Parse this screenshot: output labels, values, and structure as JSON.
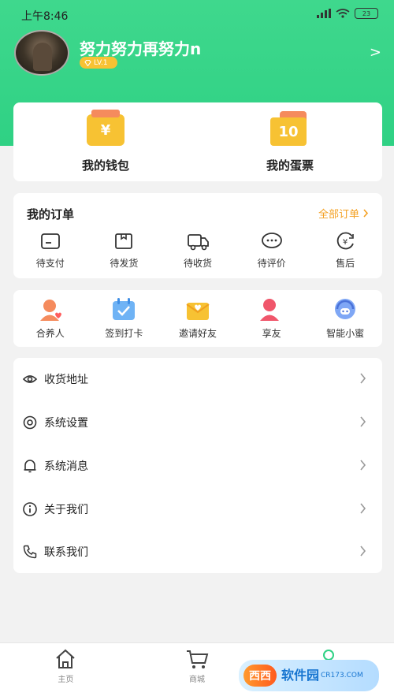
{
  "status_bar": {
    "time": "上午8:46",
    "battery": "23"
  },
  "profile": {
    "username": "努力努力再努力n",
    "level": "LV.1",
    "arrow": ">"
  },
  "wallet": {
    "wallet_icon_glyph": "¥",
    "wallet_label": "我的钱包",
    "ticket_icon_glyph": "10",
    "ticket_label": "我的蛋票"
  },
  "orders": {
    "title": "我的订单",
    "all_label": "全部订单",
    "items": [
      {
        "label": "待支付",
        "icon": "card-icon"
      },
      {
        "label": "待发货",
        "icon": "box-icon"
      },
      {
        "label": "待收货",
        "icon": "truck-icon"
      },
      {
        "label": "待评价",
        "icon": "chat-icon"
      },
      {
        "label": "售后",
        "icon": "yen-icon"
      }
    ]
  },
  "services": [
    {
      "label": "合养人",
      "icon": "partner-icon"
    },
    {
      "label": "签到打卡",
      "icon": "calendar-icon"
    },
    {
      "label": "邀请好友",
      "icon": "invite-icon"
    },
    {
      "label": "享友",
      "icon": "share-friend-icon"
    },
    {
      "label": "智能小蜜",
      "icon": "assistant-icon"
    }
  ],
  "menu": [
    {
      "label": "收货地址",
      "icon": "eye-icon"
    },
    {
      "label": "系统设置",
      "icon": "settings-icon"
    },
    {
      "label": "系统消息",
      "icon": "bell-icon"
    },
    {
      "label": "关于我们",
      "icon": "info-icon"
    },
    {
      "label": "联系我们",
      "icon": "phone-icon"
    }
  ],
  "tabbar": [
    {
      "label": "主页",
      "icon": "home-icon"
    },
    {
      "label": "商城",
      "icon": "cart-icon"
    },
    {
      "label": "",
      "icon": "user-icon"
    }
  ],
  "watermark": {
    "logo": "西西",
    "text": "软件园",
    "sub": "CR173.COM"
  },
  "colors": {
    "brand_green": "#2fd184",
    "accent_orange": "#f4a021",
    "gold": "#f7c233"
  }
}
